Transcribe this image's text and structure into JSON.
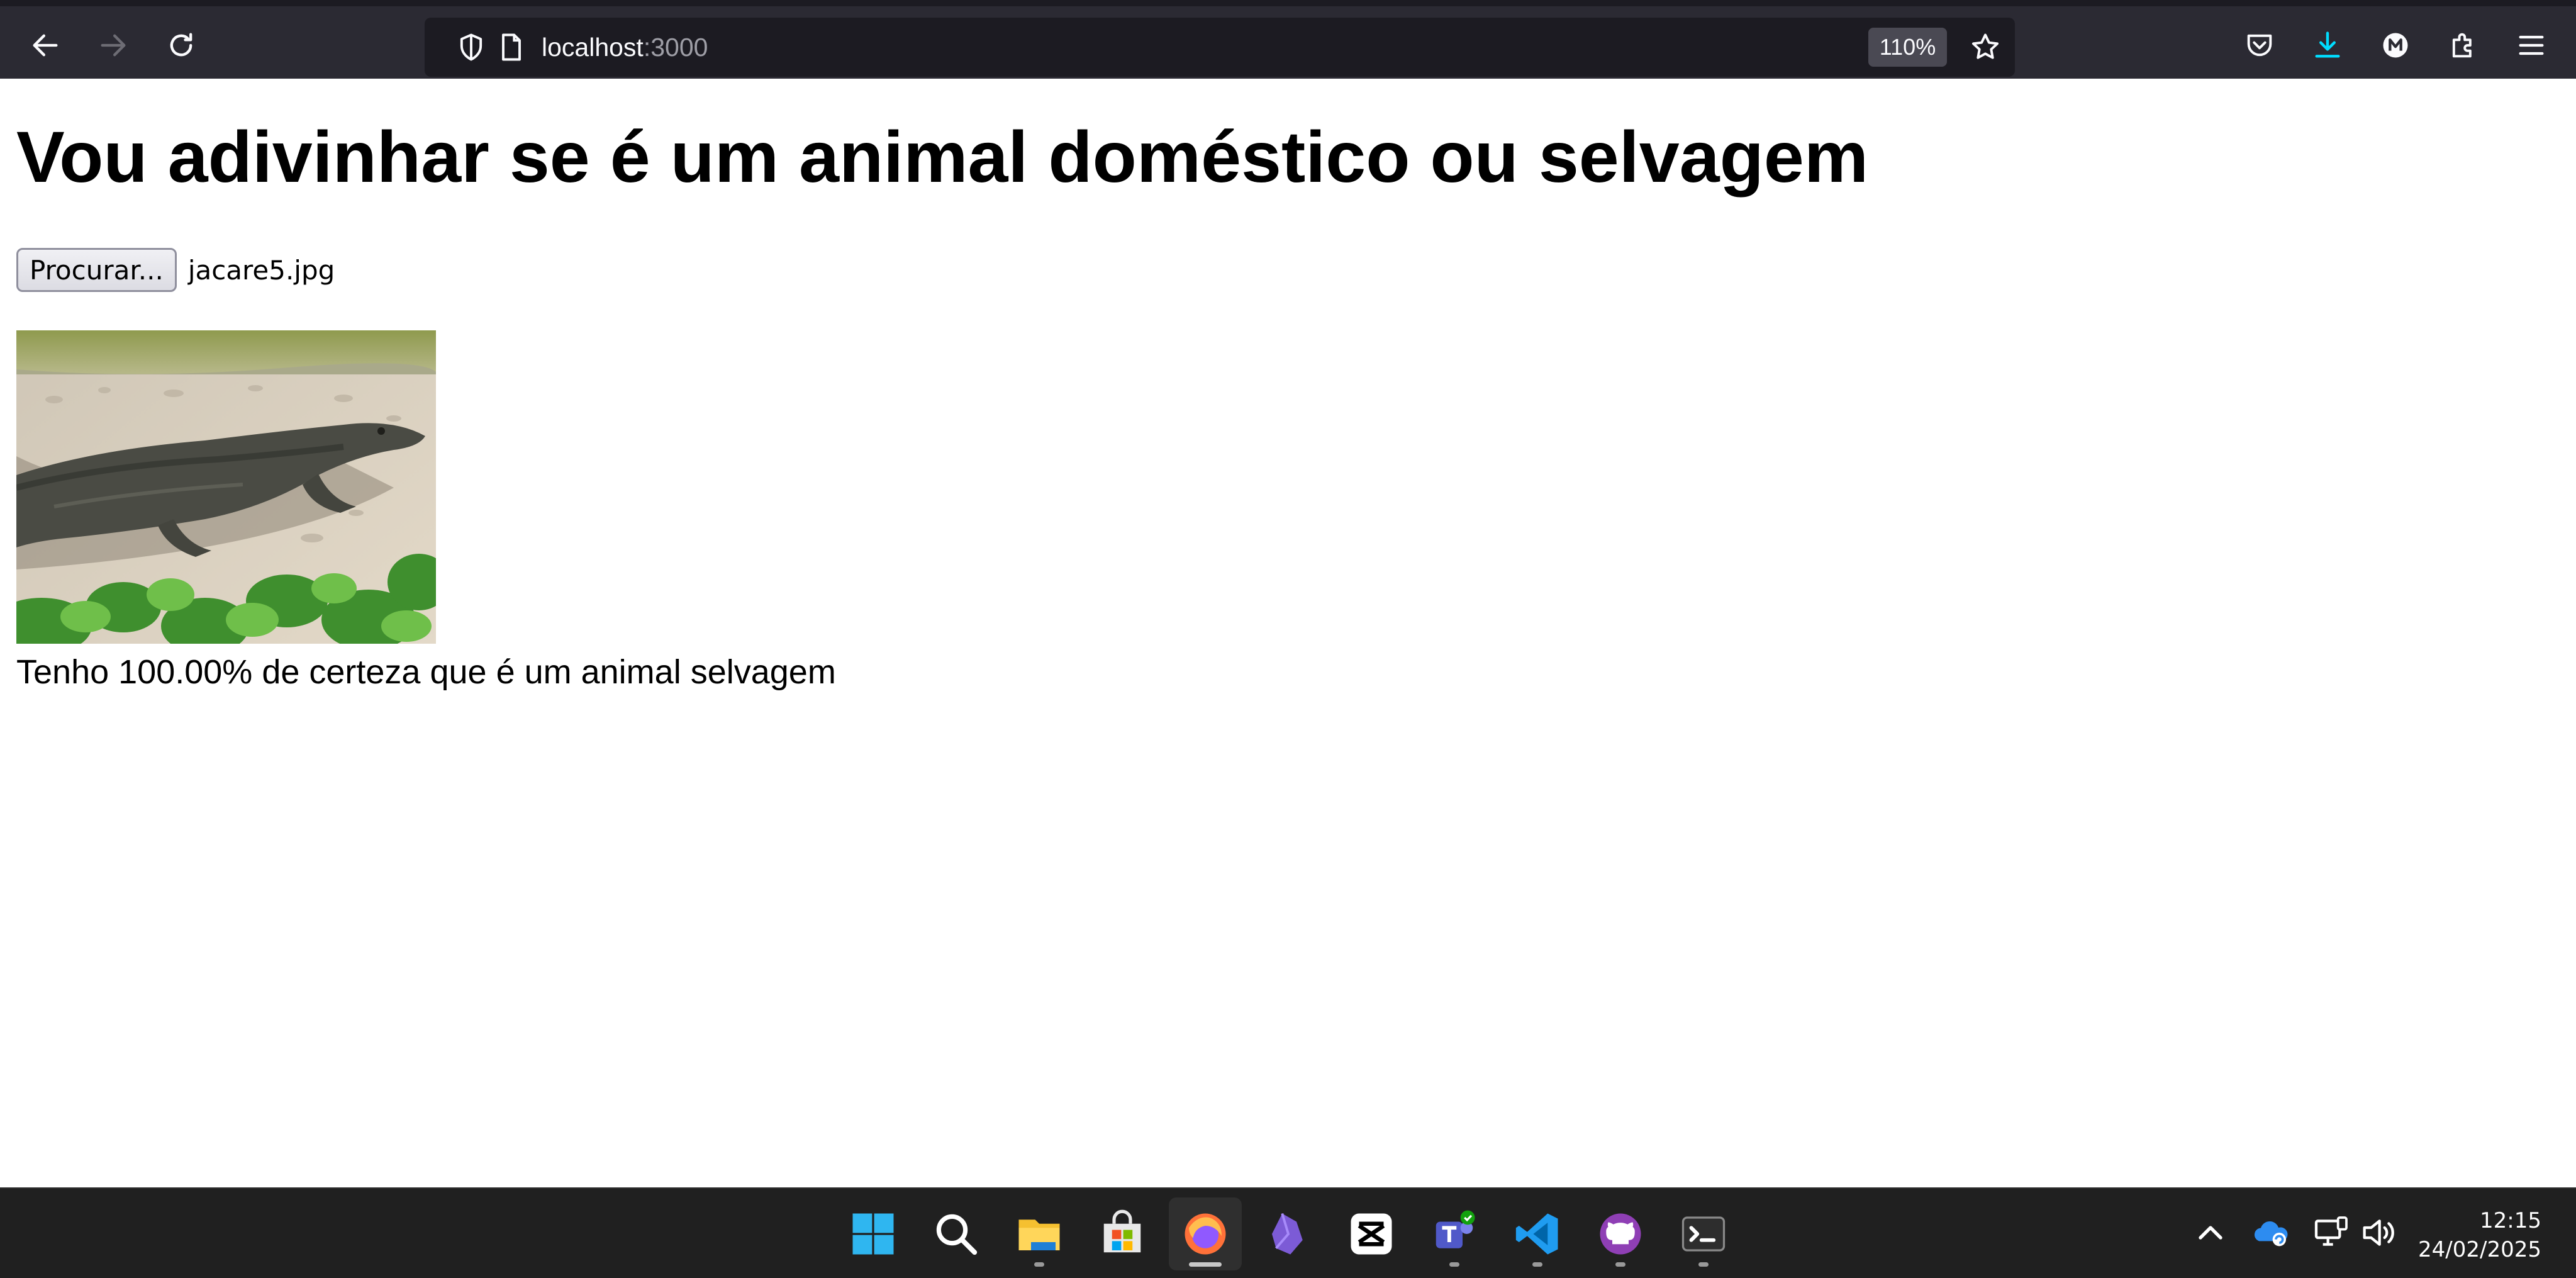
{
  "browser": {
    "url_host": "localhost",
    "url_port": ":3000",
    "zoom": "110%"
  },
  "page": {
    "title": "Vou adivinhar se é um animal doméstico ou selvagem",
    "file_button_label": "Procurar...",
    "file_name": "jacare5.jpg",
    "result": "Tenho 100.00% de certeza que é um animal selvagem"
  },
  "taskbar": {
    "apps": [
      {
        "icon": "windows-start-icon"
      },
      {
        "icon": "search-icon"
      },
      {
        "icon": "file-explorer-icon"
      },
      {
        "icon": "microsoft-store-icon"
      },
      {
        "icon": "firefox-icon"
      },
      {
        "icon": "obsidian-icon"
      },
      {
        "icon": "capcut-icon"
      },
      {
        "icon": "teams-icon"
      },
      {
        "icon": "vscode-icon"
      },
      {
        "icon": "github-desktop-icon"
      },
      {
        "icon": "terminal-icon"
      }
    ],
    "time": "12:15",
    "date": "24/02/2025"
  },
  "colors": {
    "toolbar_bg": "#2b2a33",
    "urlbar_bg": "#1c1b22",
    "download_accent": "#00ddff",
    "taskbar_bg": "#202020"
  }
}
